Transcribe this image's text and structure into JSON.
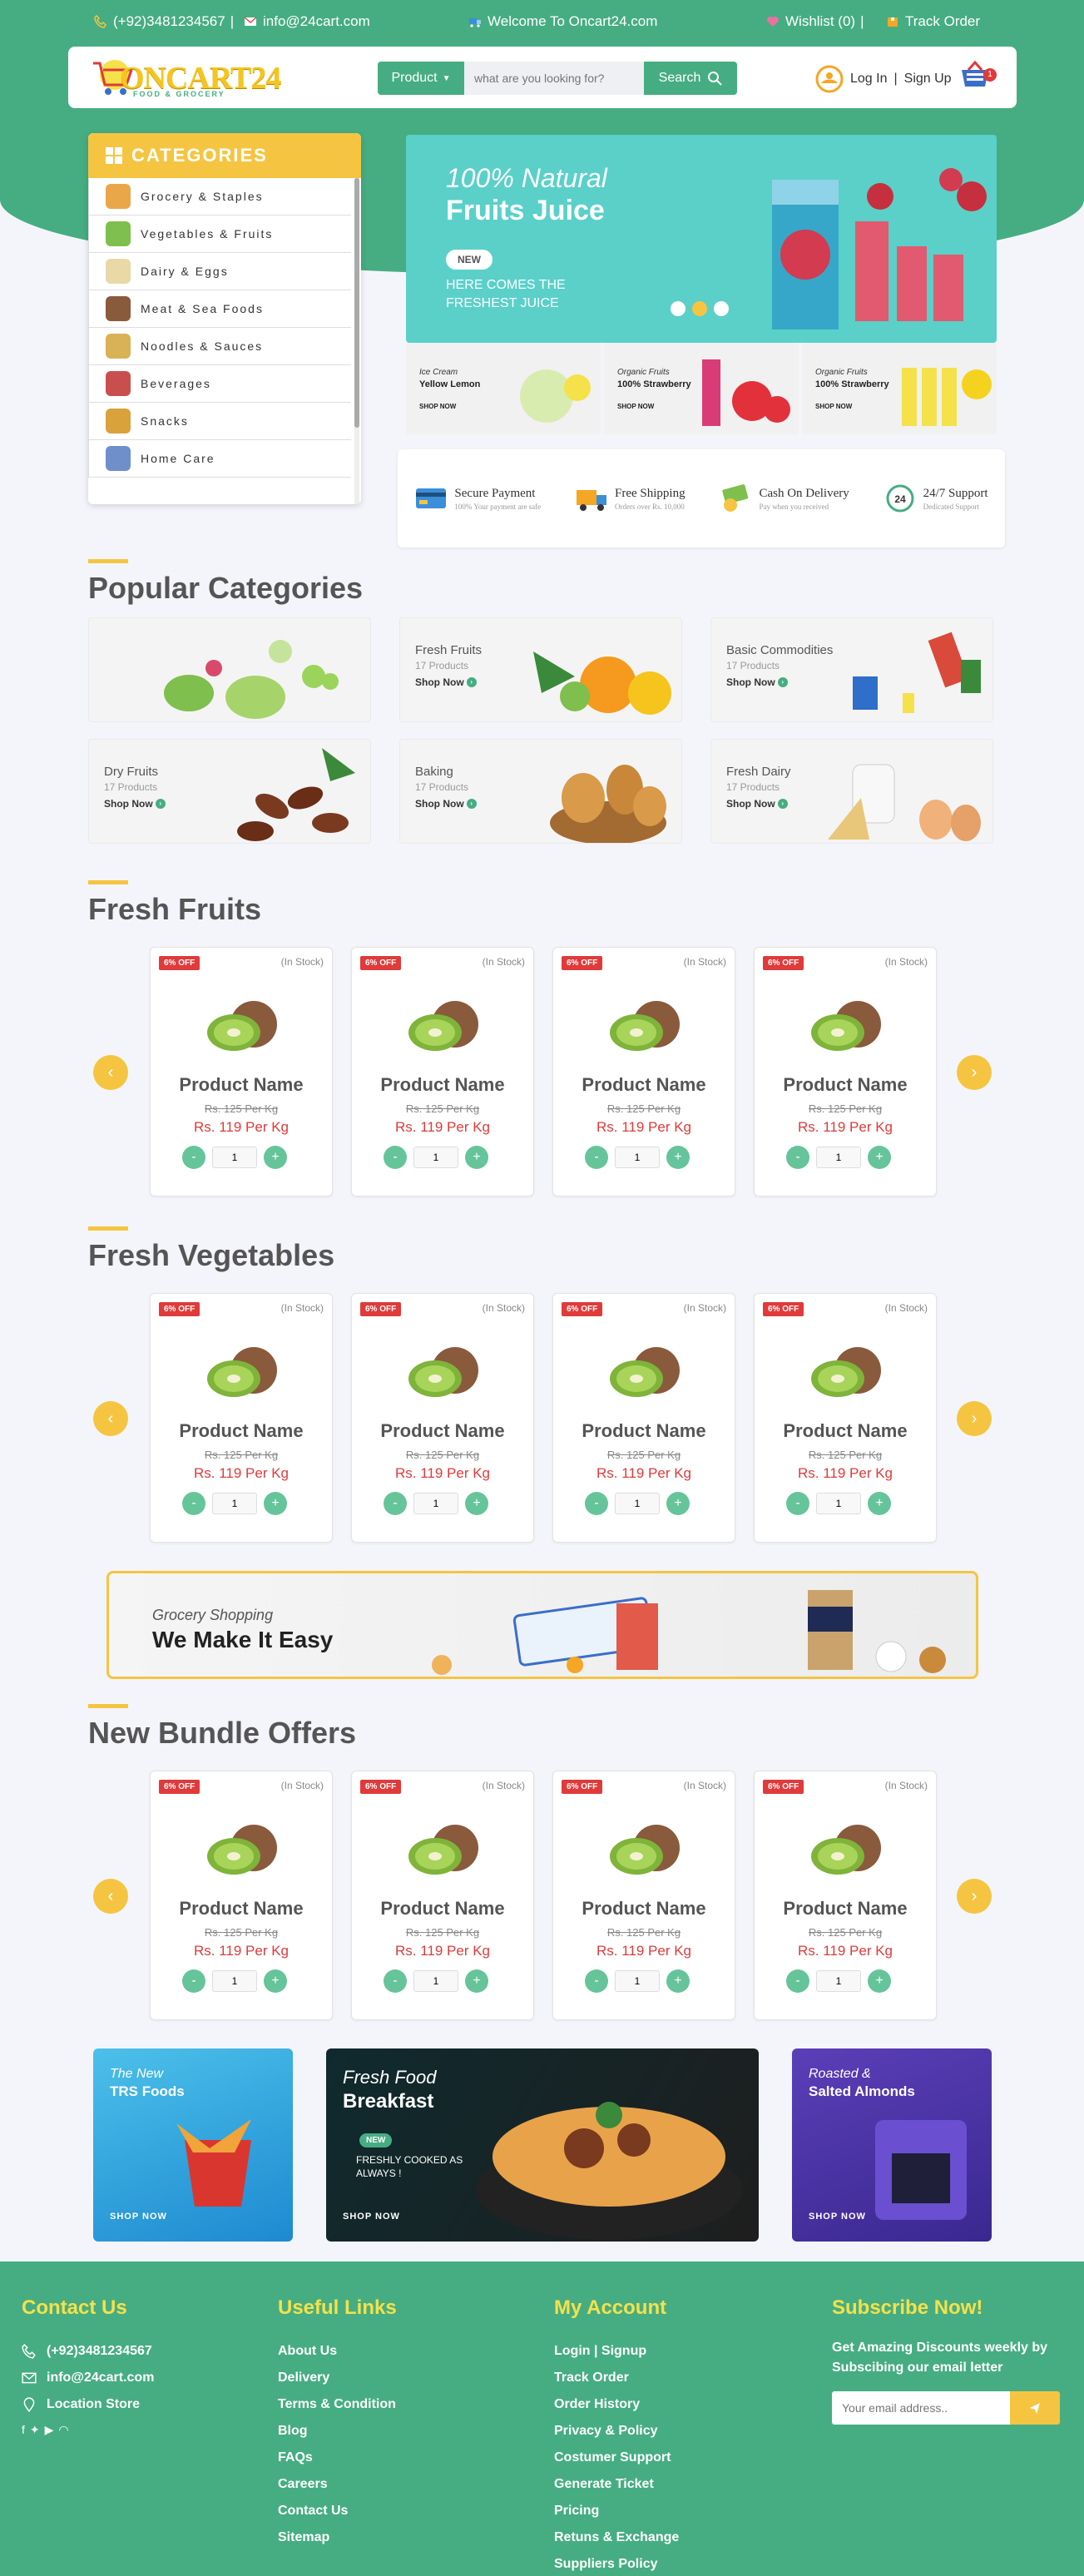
{
  "topbar": {
    "phone": "(+92)3481234567",
    "email": "info@24cart.com",
    "welcome": "Welcome To Oncart24.com",
    "wishlist": "Wishlist (0)",
    "separator": "|",
    "track": "Track Order"
  },
  "header": {
    "logo_text": "ONCART24",
    "logo_sub": "FOOD & GROCERY",
    "product_dropdown": "Product",
    "search_placeholder": "what are you looking for?",
    "search_button": "Search",
    "login": "Log In",
    "signup": "Sign Up",
    "cart_count": "1"
  },
  "categories": {
    "title": "CATEGORIES",
    "items": [
      {
        "label": "Grocery & Staples",
        "color": "#e9a74a"
      },
      {
        "label": "Vegetables & Fruits",
        "color": "#7fbf4d"
      },
      {
        "label": "Dairy & Eggs",
        "color": "#e8d9a6"
      },
      {
        "label": "Meat & Sea Foods",
        "color": "#8a5a3c"
      },
      {
        "label": "Noodles & Sauces",
        "color": "#d8b255"
      },
      {
        "label": "Beverages",
        "color": "#c94f4f"
      },
      {
        "label": "Snacks",
        "color": "#d9a23a"
      },
      {
        "label": "Home Care",
        "color": "#6e8fc9"
      }
    ]
  },
  "banner": {
    "line1": "100% Natural",
    "line2": "Fruits Juice",
    "badge": "NEW",
    "line3": "HERE COMES THE FRESHEST JUICE"
  },
  "mini_banners": [
    {
      "a": "Ice Cream",
      "b": "Yellow Lemon",
      "c": "SHOP NOW"
    },
    {
      "a": "Organic Fruits",
      "b": "100% Strawberry",
      "c": "SHOP NOW"
    },
    {
      "a": "Organic Fruits",
      "b": "100% Strawberry",
      "c": "SHOP NOW"
    }
  ],
  "features": [
    {
      "title": "Secure Payment",
      "sub": "100% Your payment are safe",
      "icon": "card-icon"
    },
    {
      "title": "Free Shipping",
      "sub": "Orders over Rs. 10,000",
      "icon": "truck-icon"
    },
    {
      "title": "Cash On Delivery",
      "sub": "Pay when you received",
      "icon": "cash-icon"
    },
    {
      "title": "24/7 Support",
      "sub": "Dedicated Support",
      "icon": "support-icon"
    }
  ],
  "popular": {
    "title": "Popular Categories",
    "cards": [
      {
        "name": "",
        "count": "",
        "shop": ""
      },
      {
        "name": "Fresh Fruits",
        "count": "17 Products",
        "shop": "Shop Now"
      },
      {
        "name": "Basic Commodities",
        "count": "17 Products",
        "shop": "Shop Now"
      },
      {
        "name": "Dry Fruits",
        "count": "17 Products",
        "shop": "Shop Now"
      },
      {
        "name": "Baking",
        "count": "17 Products",
        "shop": "Shop Now"
      },
      {
        "name": "Fresh Dairy",
        "count": "17 Products",
        "shop": "Shop Now"
      }
    ]
  },
  "product_template": {
    "off": "6% OFF",
    "stock": "(In Stock)",
    "name": "Product Name",
    "old_price": "Rs. 125 Per Kg",
    "new_price": "Rs. 119 Per Kg",
    "qty": "1",
    "minus": "-",
    "plus": "+"
  },
  "sections": {
    "fruits": "Fresh Fruits",
    "vegetables": "Fresh Vegetables",
    "bundles": "New Bundle Offers"
  },
  "easy_banner": {
    "line1": "Grocery Shopping",
    "line2": "We Make It Easy"
  },
  "promos": [
    {
      "a": "The New",
      "b": "TRS Foods",
      "sn": "SHOP NOW"
    },
    {
      "a": "Fresh Food",
      "b": "Breakfast",
      "badge": "NEW",
      "c": "FRESHLY COOKED AS ALWAYS !",
      "sn": "SHOP NOW"
    },
    {
      "a": "Roasted &",
      "b": "Salted Almonds",
      "sn": "SHOP NOW"
    }
  ],
  "footer": {
    "contact": {
      "title": "Contact Us",
      "phone": "(+92)3481234567",
      "email": "info@24cart.com",
      "location": "Location Store"
    },
    "useful": {
      "title": "Useful Links",
      "links": [
        "About Us",
        "Delivery",
        "Terms & Condition",
        "Blog",
        "FAQs",
        "Careers",
        "Contact Us",
        "Sitemap"
      ]
    },
    "account": {
      "title": "My Account",
      "links": [
        "Login | Signup",
        "Track Order",
        "Order History",
        "Privacy & Policy",
        "Costumer Support",
        "Generate Ticket",
        "Pricing",
        "Retuns & Exchange",
        "Suppliers Policy"
      ]
    },
    "subscribe": {
      "title": "Subscribe Now!",
      "text": "Get Amazing Discounts weekly by Subscibing our email letter",
      "placeholder": "Your email address.."
    }
  },
  "colors": {
    "brand": "#46ad82",
    "accent": "#f5c542",
    "sale": "#e03a3a"
  }
}
